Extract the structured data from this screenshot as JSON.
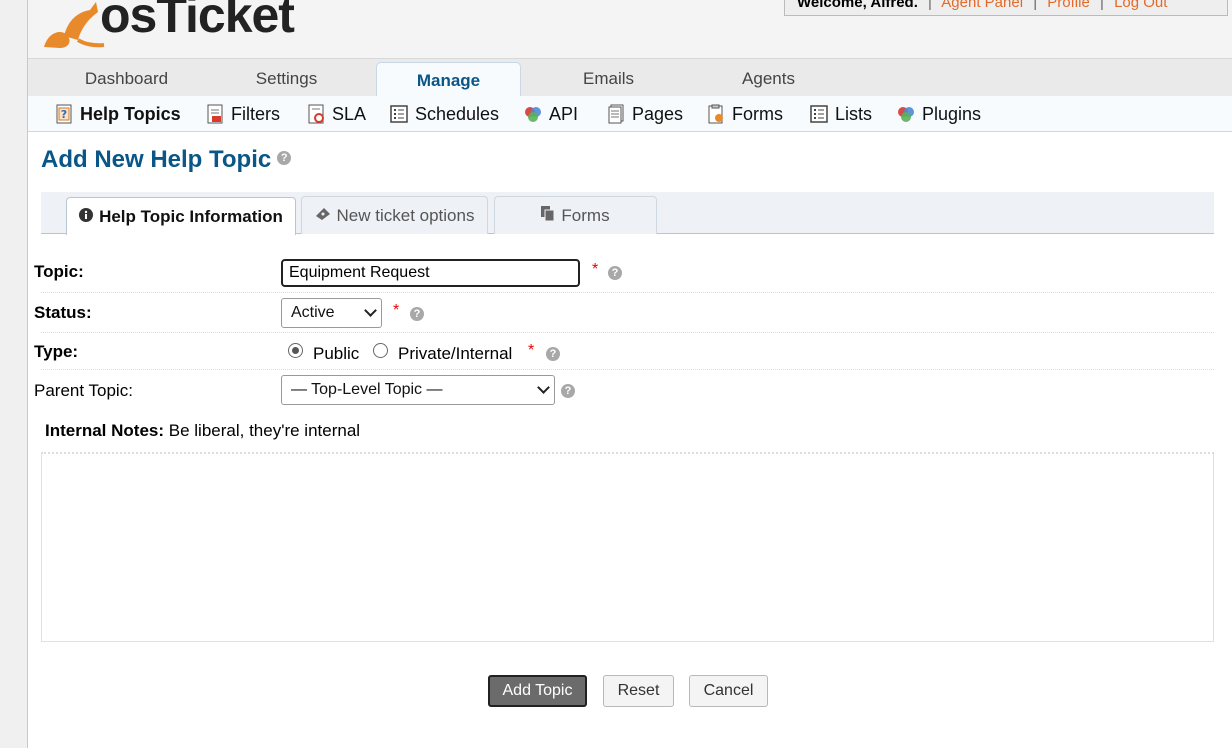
{
  "header": {
    "logo_text": "osTicket",
    "welcome_text": "Welcome, Alfred.",
    "links": [
      "Agent Panel",
      "Profile",
      "Log Out"
    ]
  },
  "nav": {
    "tabs": [
      "Dashboard",
      "Settings",
      "Manage",
      "Emails",
      "Agents"
    ],
    "active": "Manage"
  },
  "subnav": {
    "items": [
      "Help Topics",
      "Filters",
      "SLA",
      "Schedules",
      "API",
      "Pages",
      "Forms",
      "Lists",
      "Plugins"
    ],
    "active": "Help Topics"
  },
  "page": {
    "title": "Add New Help Topic"
  },
  "tabs": [
    "Help Topic Information",
    "New ticket options",
    "Forms"
  ],
  "form": {
    "topic_label": "Topic:",
    "topic_value": "Equipment Request",
    "status_label": "Status:",
    "status_value": "Active",
    "type_label": "Type:",
    "type_public": "Public",
    "type_private": "Private/Internal",
    "parent_label": "Parent Topic:",
    "parent_value": "— Top-Level Topic —",
    "notes_label": "Internal Notes:",
    "notes_hint": "Be liberal, they're internal",
    "required_mark": "*"
  },
  "buttons": {
    "add": "Add Topic",
    "reset": "Reset",
    "cancel": "Cancel"
  },
  "colors": {
    "brand_blue": "#0a5687",
    "logo_orange": "#e8892b",
    "link_orange": "#e46a2a"
  }
}
